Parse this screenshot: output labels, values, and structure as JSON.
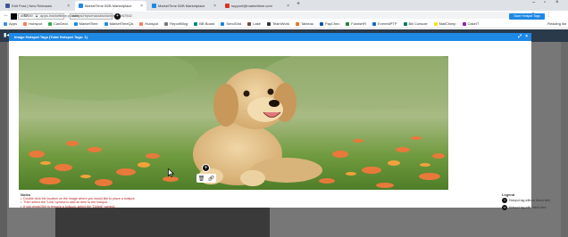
{
  "browser": {
    "tabs": [
      {
        "label": "Edit Post | New Releases",
        "active": false,
        "color": "#3b5998"
      },
      {
        "label": "MarketTime B2B Marketplace",
        "active": true,
        "color": "#1e88e5"
      },
      {
        "label": "MarketTime B2B Marketplace",
        "active": false,
        "color": "#1e88e5"
      },
      {
        "label": "support@markettime.com",
        "active": false,
        "color": "#d93025"
      }
    ],
    "new_tab": "+",
    "url": "apps.markettime.com/reps/reps/manufacturer/edit/947502",
    "bookmarks": [
      {
        "label": "Apps",
        "color": "#4285f4"
      },
      {
        "label": "Hubspot",
        "color": "#ff7a59"
      },
      {
        "label": "CanDeal",
        "color": "#34a853"
      },
      {
        "label": "MarketTime",
        "color": "#1e88e5"
      },
      {
        "label": "MarketTimeQA",
        "color": "#1e88e5"
      },
      {
        "label": "Hubspot",
        "color": "#ff7a59"
      },
      {
        "label": "ReportBlog",
        "color": "#777777"
      },
      {
        "label": "BB Board",
        "color": "#00897b"
      },
      {
        "label": "SendGrid",
        "color": "#1a82e2"
      },
      {
        "label": "Lake",
        "color": "#6d4c41"
      },
      {
        "label": "TeamWork",
        "color": "#333333"
      },
      {
        "label": "Tableau",
        "color": "#e97627"
      },
      {
        "label": "PayChex",
        "color": "#0055a5"
      },
      {
        "label": "FundsHR",
        "color": "#2e7d32"
      },
      {
        "label": "EverestPTP",
        "color": "#1565c0"
      },
      {
        "label": "Bill Console",
        "color": "#00796b"
      },
      {
        "label": "MailChimp",
        "color": "#ffe01b"
      },
      {
        "label": "CakeIT",
        "color": "#8e24aa"
      }
    ],
    "reading_list": "Reading list"
  },
  "modal": {
    "title": "Image Hotspot Tags (Total Hotspot Tags: 1)",
    "color_value": "#000000",
    "size_value": "auto",
    "save_label": "Save Hotspot Tags",
    "notes_title": "Notes",
    "notes": [
      "Double click the location on the image where you would like to place a hotspot.",
      "Then select the \"Link\" symbol to add an item to the hotspot.",
      "If you would like to remove a hotspot, select the \"Delete\" symbol."
    ],
    "legend_title": "Legend",
    "legend": [
      {
        "label": "Hotspot tag without linked item",
        "icon": "plus-icon"
      },
      {
        "label": "Hotspot tag with linked item",
        "icon": "link-icon"
      }
    ],
    "hotspot_symbol": "+"
  },
  "colors": {
    "accent": "#1e88e5",
    "note_text": "#b71c1c"
  }
}
